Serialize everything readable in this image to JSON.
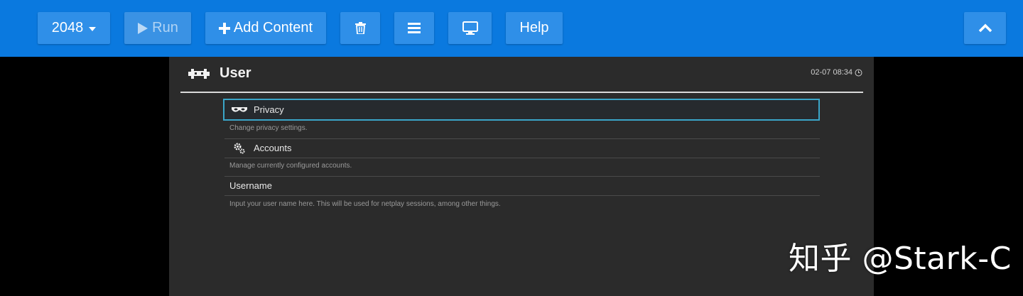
{
  "toolbar": {
    "game_select": "2048",
    "run_label": "Run",
    "add_content_label": "Add Content",
    "help_label": "Help",
    "icons": {
      "run": "play-icon",
      "add": "plus-icon",
      "delete": "trash-icon",
      "menu": "menu-icon",
      "fullscreen": "monitor-icon",
      "collapse": "chevron-up-icon"
    },
    "colors": {
      "bar": "#0a79df",
      "button": "#2f8fe8"
    }
  },
  "screen": {
    "title": "User",
    "clock": "02-07 08:34",
    "items": [
      {
        "label": "Privacy",
        "sublabel": "Change privacy settings.",
        "icon": "mask-icon",
        "selected": true
      },
      {
        "label": "Accounts",
        "sublabel": "Manage currently configured accounts.",
        "icon": "gears-icon",
        "selected": false
      },
      {
        "label": "Username",
        "sublabel": "Input your user name here. This will be used for netplay sessions, among other things.",
        "icon": "",
        "selected": false
      }
    ],
    "colors": {
      "background": "#2b2b2b",
      "selection": "#3aa6c9"
    }
  },
  "watermark": "知乎 @Stark-C"
}
